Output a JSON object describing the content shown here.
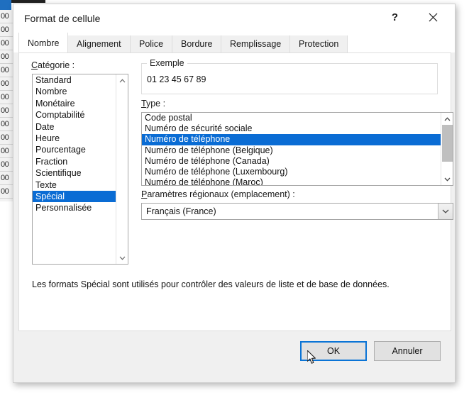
{
  "background": {
    "row_labels": [
      "00",
      "00",
      "00",
      "00",
      "00",
      "00",
      "00",
      "00",
      "00",
      "00",
      "00",
      "00",
      "00",
      "00"
    ]
  },
  "dialog": {
    "title": "Format de cellule",
    "help_icon": "?",
    "close_icon": "close-icon",
    "tabs": [
      {
        "label": "Nombre",
        "active": true
      },
      {
        "label": "Alignement",
        "active": false
      },
      {
        "label": "Police",
        "active": false
      },
      {
        "label": "Bordure",
        "active": false
      },
      {
        "label": "Remplissage",
        "active": false
      },
      {
        "label": "Protection",
        "active": false
      }
    ],
    "category": {
      "label_accel": "C",
      "label_rest": "atégorie :",
      "items": [
        "Standard",
        "Nombre",
        "Monétaire",
        "Comptabilité",
        "Date",
        "Heure",
        "Pourcentage",
        "Fraction",
        "Scientifique",
        "Texte",
        "Spécial",
        "Personnalisée"
      ],
      "selected": "Spécial"
    },
    "example": {
      "legend": "Exemple",
      "value": "01 23 45 67 89"
    },
    "type": {
      "label_accel": "T",
      "label_rest": "ype :",
      "items": [
        "Code postal",
        "Numéro de sécurité sociale",
        "Numéro de téléphone",
        "Numéro de téléphone (Belgique)",
        "Numéro de téléphone (Canada)",
        "Numéro de téléphone (Luxembourg)",
        "Numéro de téléphone (Maroc)"
      ],
      "selected": "Numéro de téléphone"
    },
    "locale": {
      "label_accel": "P",
      "label_rest": "aramètres régionaux (emplacement) :",
      "value": "Français (France)",
      "arrow_icon": "chevron-down-icon"
    },
    "description": "Les formats Spécial sont utilisés pour contrôler des valeurs de liste et de base de données.",
    "buttons": {
      "ok": "OK",
      "cancel": "Annuler"
    }
  },
  "colors": {
    "selection_blue": "#0a6cd4",
    "focus_blue": "#0a74d6",
    "dialog_bg": "#f0f0f0",
    "page_bg": "#ffffff"
  }
}
